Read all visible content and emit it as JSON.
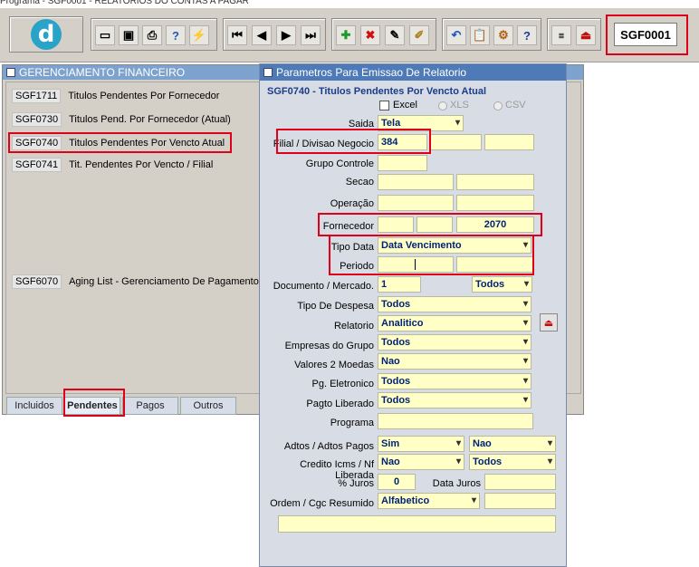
{
  "window": {
    "title": "Programa - SGF0001 - RELATORIOS DO CONTAS A PAGAR"
  },
  "toolbar": {
    "program_code": "SGF0001"
  },
  "menu_window": {
    "title": "GERENCIAMENTO FINANCEIRO",
    "items": [
      {
        "code": "SGF1711",
        "label": "Titulos Pendentes Por Fornecedor"
      },
      {
        "code": "SGF0730",
        "label": "Titulos Pend. Por Fornecedor (Atual)"
      },
      {
        "code": "SGF0740",
        "label": "Titulos Pendentes Por Vencto Atual"
      },
      {
        "code": "SGF0741",
        "label": "Tit. Pendentes Por Vencto / Filial"
      },
      {
        "code": "SGF6070",
        "label": "Aging List - Gerenciamento De Pagamentos"
      }
    ],
    "tabs": [
      "Incluidos",
      "Pendentes",
      "Pagos",
      "Outros"
    ]
  },
  "params_window": {
    "title": "Parametros Para Emissao De Relatorio",
    "subtitle": "SGF0740 - Titulos Pendentes Por Vencto Atual",
    "excel_label": "Excel",
    "xls_label": "XLS",
    "csv_label": "CSV",
    "labels": {
      "saida": "Saida",
      "filial": "Filial / Divisao Negocio",
      "grupo": "Grupo Controle",
      "secao": "Secao",
      "operacao": "Operação",
      "fornecedor": "Fornecedor",
      "tipo_data": "Tipo Data",
      "periodo": "Periodo",
      "documento": "Documento / Mercado.",
      "tipo_despesa": "Tipo De Despesa",
      "relatorio": "Relatorio",
      "empresas": "Empresas do Grupo",
      "valores": "Valores 2 Moedas",
      "pg_eletronico": "Pg. Eletronico",
      "pagto_liberado": "Pagto Liberado",
      "programa": "Programa",
      "adtos": "Adtos / Adtos Pagos",
      "credito": "Credito Icms / Nf Liberada",
      "juros": "% Juros",
      "data_juros": "Data Juros",
      "ordem": "Ordem / Cgc Resumido"
    },
    "values": {
      "saida": "Tela",
      "filial": "384",
      "fornecedor": "2070",
      "tipo_data": "Data Vencimento",
      "documento": "1",
      "mercado": "Todos",
      "tipo_despesa": "Todos",
      "relatorio": "Analitico",
      "empresas": "Todos",
      "valores": "Nao",
      "pg_eletronico": "Todos",
      "pagto_liberado": "Todos",
      "adtos": "Sim",
      "adtos_pagos": "Nao",
      "credito": "Nao",
      "nf_liberada": "Todos",
      "juros": "0",
      "ordem": "Alfabetico"
    }
  }
}
